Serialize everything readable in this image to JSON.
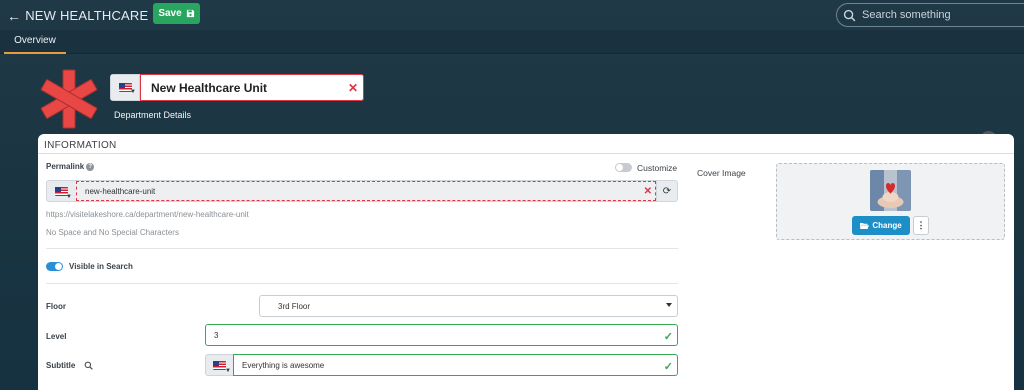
{
  "header": {
    "title": "NEW HEALTHCARE UNIT",
    "save_label": "Save",
    "search_placeholder": "Search something"
  },
  "tabs": [
    {
      "label": "Overview",
      "active": true
    }
  ],
  "unit": {
    "name": "New Healthcare Unit",
    "subtitle_label": "Department Details",
    "logo_icon": "red-asterisk-star",
    "logo_color": "#e84745"
  },
  "info": {
    "section_title": "INFORMATION",
    "permalink_label": "Permalink",
    "customize_label": "Customize",
    "customize_on": false,
    "permalink_value": "new-healthcare-unit",
    "permalink_url": "https://visitelakeshore.ca/department/new-healthcare-unit",
    "permalink_hint": "No Space and No Special Characters",
    "visible_label": "Visible in Search",
    "visible_on": true,
    "floor_label": "Floor",
    "floor_value": "3rd Floor",
    "level_label": "Level",
    "level_value": "3",
    "subtitle_label": "Subtitle",
    "subtitle_value": "Everything is awesome",
    "cover_label": "Cover Image",
    "change_label": "Change"
  },
  "colors": {
    "save_green": "#28a55f",
    "tab_underline": "#e89a3c",
    "error_red": "#dc3545",
    "valid_green": "#35a853",
    "toggle_blue": "#2a8fd9",
    "change_blue": "#1e8ec6"
  },
  "icons": {
    "back": "arrow-left-icon",
    "save": "floppy-disk-icon",
    "search": "search-icon",
    "clear": "close-icon",
    "refresh": "refresh-icon",
    "info": "info-icon",
    "help": "question-icon",
    "folder": "folder-open-icon",
    "more": "vertical-dots-icon",
    "flag": "us-flag-icon"
  }
}
